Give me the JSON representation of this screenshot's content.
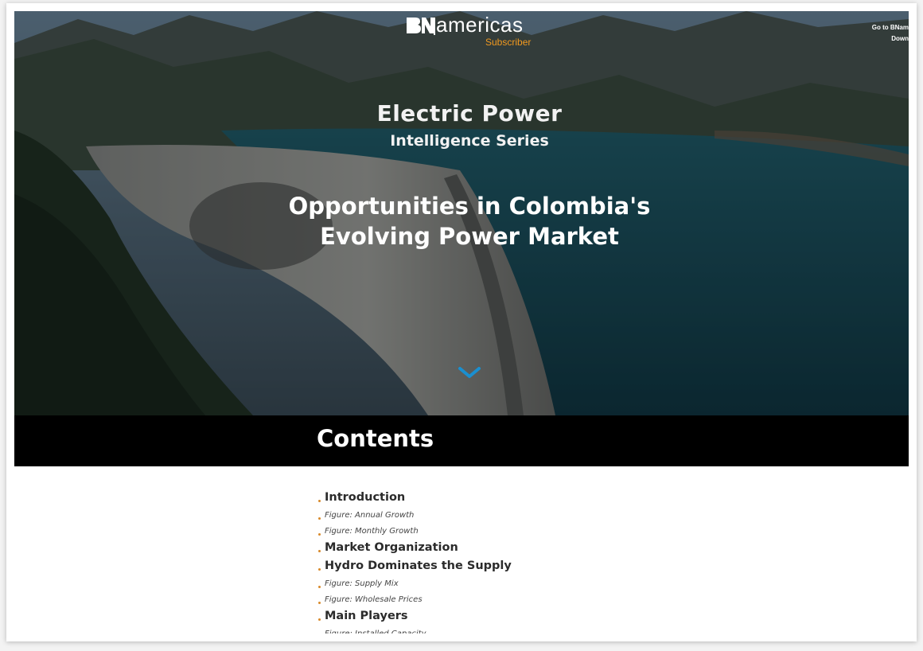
{
  "hero": {
    "logo": {
      "brand": "americas",
      "subtitle": "Subscriber"
    },
    "top_links": [
      "Go to BNam",
      "Down"
    ],
    "series_title": "Electric Power",
    "series_subtitle": "Intelligence Series",
    "report_title": "Opportunities in Colombia's Evolving Power Market",
    "scroll_icon": "chevron-down-icon"
  },
  "contents": {
    "heading": "Contents",
    "items": [
      {
        "type": "section",
        "label": "Introduction"
      },
      {
        "type": "figure",
        "label": "Figure: Annual Growth"
      },
      {
        "type": "figure",
        "label": "Figure: Monthly Growth"
      },
      {
        "type": "section",
        "label": "Market Organization"
      },
      {
        "type": "section",
        "label": "Hydro Dominates the Supply"
      },
      {
        "type": "figure",
        "label": "Figure: Supply Mix"
      },
      {
        "type": "figure",
        "label": "Figure: Wholesale Prices"
      },
      {
        "type": "section",
        "label": "Main Players"
      },
      {
        "type": "figure",
        "label": "Figure: Installed Capacity"
      }
    ]
  },
  "colors": {
    "accent_orange": "#f29a1f",
    "chevron_blue": "#1a8fd0",
    "bar_black": "#000000"
  }
}
